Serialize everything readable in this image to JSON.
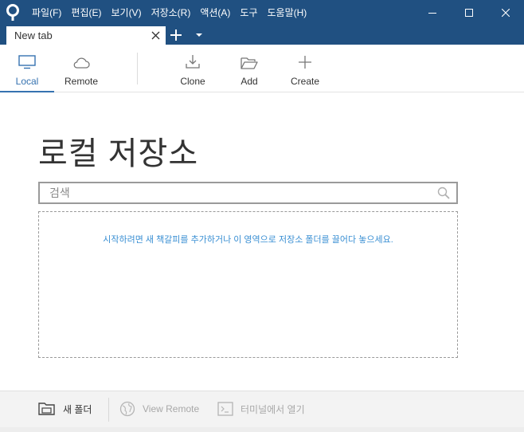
{
  "titlebar": {
    "menu": [
      "파일(F)",
      "편집(E)",
      "보기(V)",
      "저장소(R)",
      "액션(A)",
      "도구",
      "도움말(H)"
    ]
  },
  "tabs": {
    "active_label": "New tab"
  },
  "toolbar": {
    "local": "Local",
    "remote": "Remote",
    "clone": "Clone",
    "add": "Add",
    "create": "Create",
    "active": "local"
  },
  "main": {
    "title": "로컬 저장소",
    "search_placeholder": "검색",
    "dropzone_message": "시작하려면 새 책갈피를 추가하거나 이 영역으로 저장소 폴더를 끌어다 놓으세요."
  },
  "bottombar": {
    "new_folder": "새 폴더",
    "view_remote": "View Remote",
    "open_terminal": "터미널에서 열기"
  },
  "colors": {
    "titlebar": "#205081",
    "accent": "#3572b0",
    "message": "#3a8fd3"
  }
}
